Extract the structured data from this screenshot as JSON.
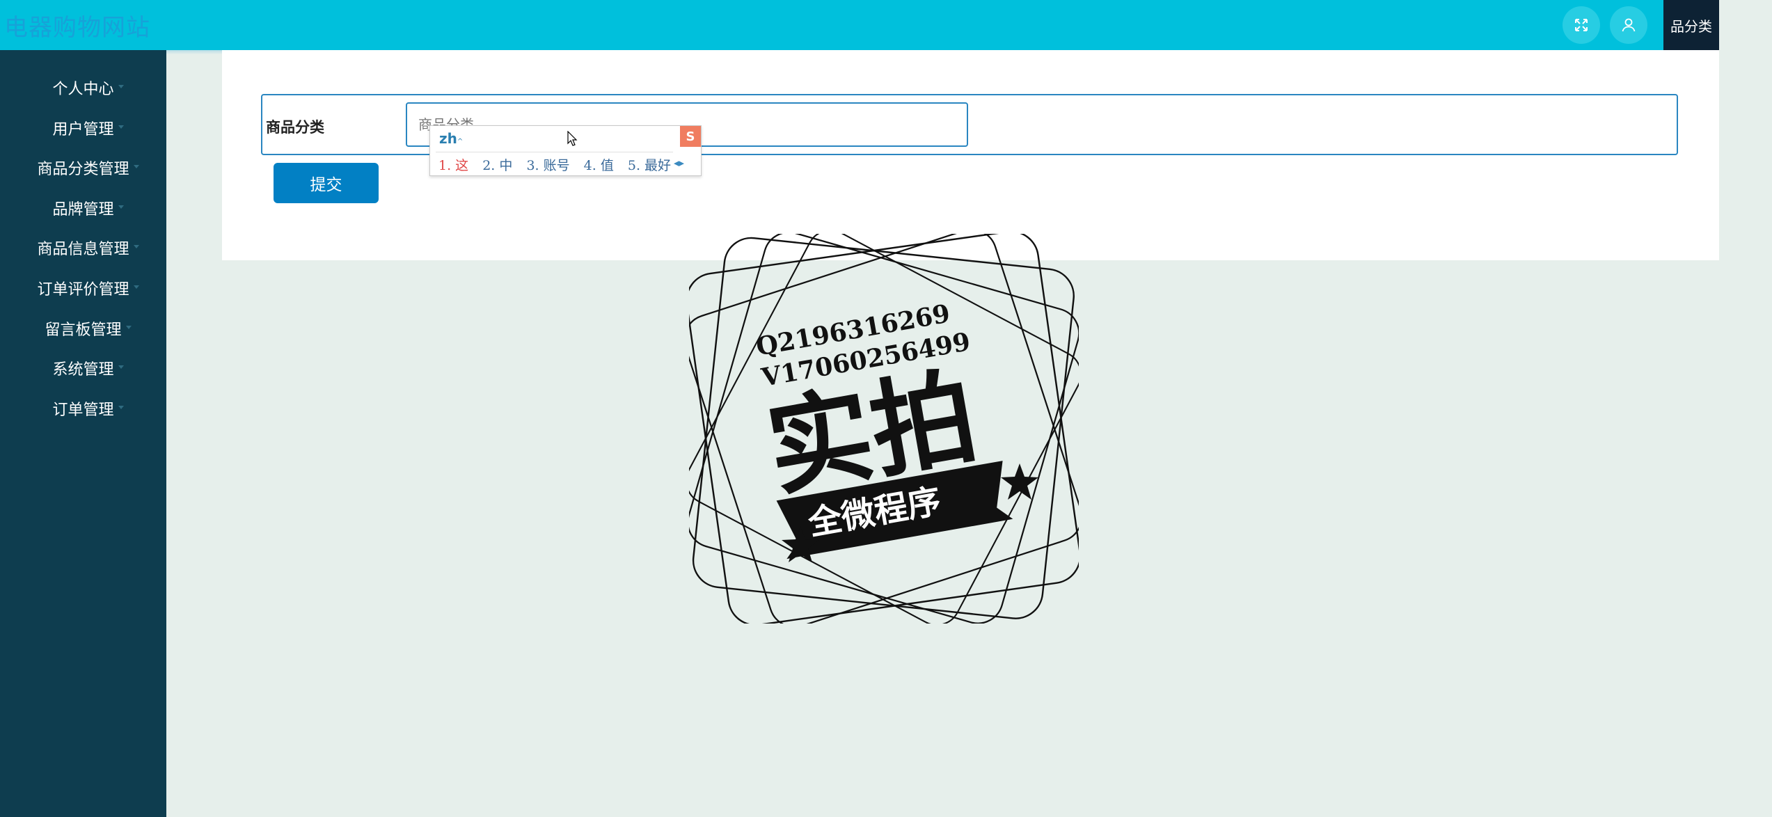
{
  "header": {
    "app_title": "电器购物网站",
    "active_tab_label": "品分类",
    "icons": [
      "fullscreen-icon",
      "user-icon"
    ]
  },
  "sidebar": {
    "items": [
      {
        "label": "个人中心"
      },
      {
        "label": "用户管理"
      },
      {
        "label": "商品分类管理"
      },
      {
        "label": "品牌管理"
      },
      {
        "label": "商品信息管理"
      },
      {
        "label": "订单评价管理"
      },
      {
        "label": "留言板管理"
      },
      {
        "label": "系统管理"
      },
      {
        "label": "订单管理"
      }
    ]
  },
  "form": {
    "field_label": "商品分类",
    "field_placeholder": "商品分类",
    "field_value": "",
    "submit_label": "提交"
  },
  "ime": {
    "pinyin": "zh",
    "logo": "S",
    "candidates": [
      "1. 这",
      "2. 中",
      "3. 账号",
      "4. 值",
      "5. 最好"
    ]
  },
  "watermark": {
    "line1": "Q2196316269",
    "line2": "V17060256499",
    "main_text": "实拍",
    "banner_text": "全微程序"
  },
  "colors": {
    "topbar": "#00c0dc",
    "sidebar": "#0e3d4f",
    "accent": "#0280c4",
    "content_bg": "#e6efeb"
  }
}
